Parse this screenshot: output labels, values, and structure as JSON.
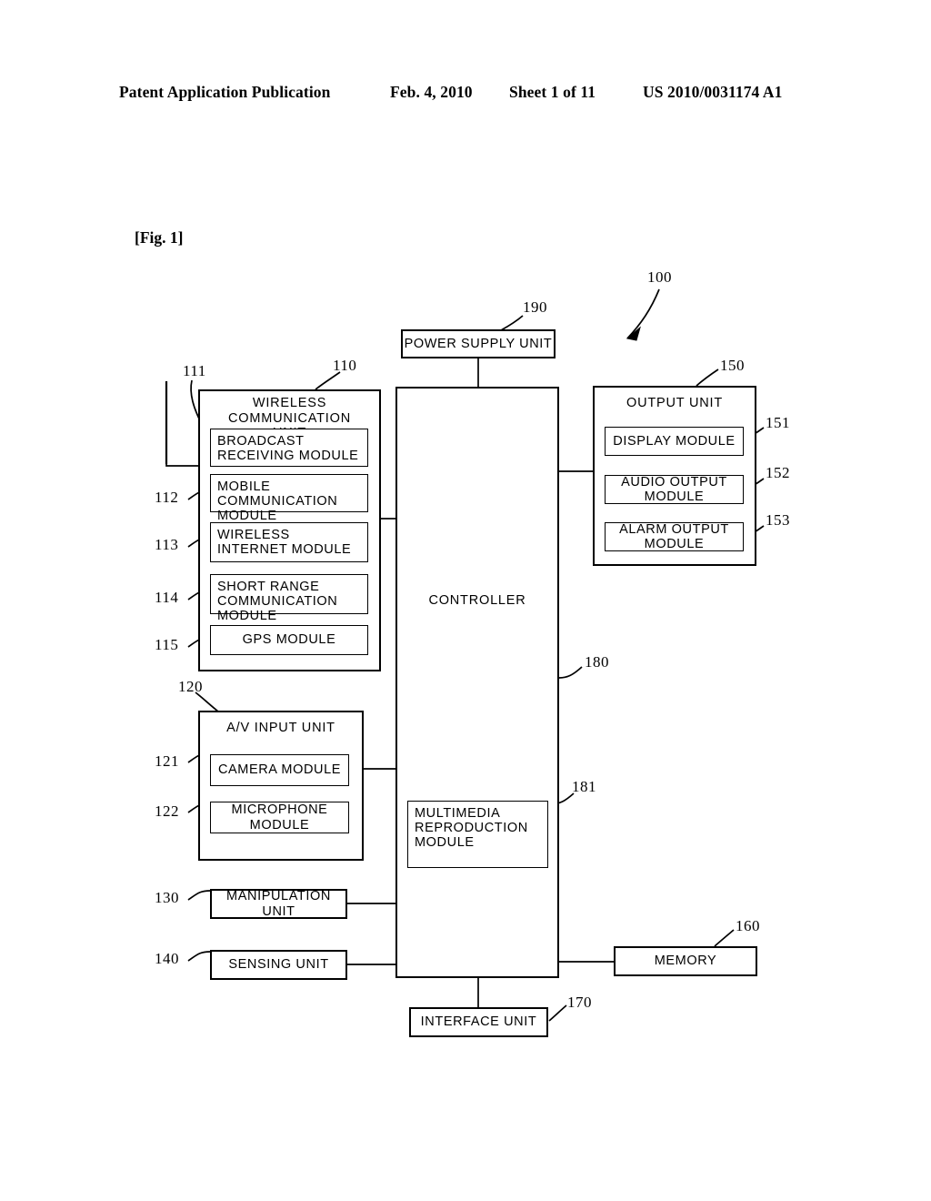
{
  "header": {
    "publication": "Patent Application Publication",
    "date": "Feb. 4, 2010",
    "sheet": "Sheet 1 of 11",
    "patent_number": "US 2010/0031174 A1"
  },
  "figure": {
    "label": "[Fig. 1]",
    "system_ref": "100"
  },
  "blocks": {
    "power_supply": {
      "label": "POWER SUPPLY UNIT",
      "ref": "190"
    },
    "wireless_unit": {
      "label": "WIRELESS COMMUNICATION UNIT",
      "ref": "110"
    },
    "broadcast": {
      "label": "BROADCAST RECEIVING MODULE",
      "ref": "111"
    },
    "mobile_comm": {
      "label": "MOBILE COMMUNICATION MODULE",
      "ref": "112"
    },
    "wireless_internet": {
      "label": "WIRELESS INTERNET MODULE",
      "ref": "113"
    },
    "short_range": {
      "label": "SHORT RANGE COMMUNICATION MODULE",
      "ref": "114"
    },
    "gps": {
      "label": "GPS MODULE",
      "ref": "115"
    },
    "av_input": {
      "label": "A/V INPUT UNIT",
      "ref": "120"
    },
    "camera": {
      "label": "CAMERA MODULE",
      "ref": "121"
    },
    "microphone": {
      "label": "MICROPHONE MODULE",
      "ref": "122"
    },
    "manipulation": {
      "label": "MANIPULATION UNIT",
      "ref": "130"
    },
    "sensing": {
      "label": "SENSING UNIT",
      "ref": "140"
    },
    "output_unit": {
      "label": "OUTPUT UNIT",
      "ref": "150"
    },
    "display": {
      "label": "DISPLAY MODULE",
      "ref": "151"
    },
    "audio_output": {
      "label": "AUDIO OUTPUT MODULE",
      "ref": "152"
    },
    "alarm_output": {
      "label": "ALARM OUTPUT MODULE",
      "ref": "153"
    },
    "memory": {
      "label": "MEMORY",
      "ref": "160"
    },
    "interface": {
      "label": "INTERFACE UNIT",
      "ref": "170"
    },
    "controller": {
      "label": "CONTROLLER",
      "ref": "180"
    },
    "multimedia": {
      "label": "MULTIMEDIA REPRODUCTION MODULE",
      "ref": "181"
    }
  },
  "lines": {
    "broadcast_l1": "BROADCAST",
    "broadcast_l2": "RECEIVING MODULE",
    "mobile_l1": "MOBILE",
    "mobile_l2": "COMMUNICATION MODULE",
    "internet_l1": "WIRELESS",
    "internet_l2": "INTERNET MODULE",
    "short_l1": "SHORT RANGE",
    "short_l2": "COMMUNICATION MODULE",
    "wireless_title_l1": "WIRELESS COMMUNICATION",
    "wireless_title_l2": "UNIT",
    "multimedia_l1": "MULTIMEDIA",
    "multimedia_l2": "REPRODUCTION",
    "multimedia_l3": "MODULE"
  },
  "colors": {
    "ink": "#000000",
    "paper": "#ffffff"
  }
}
